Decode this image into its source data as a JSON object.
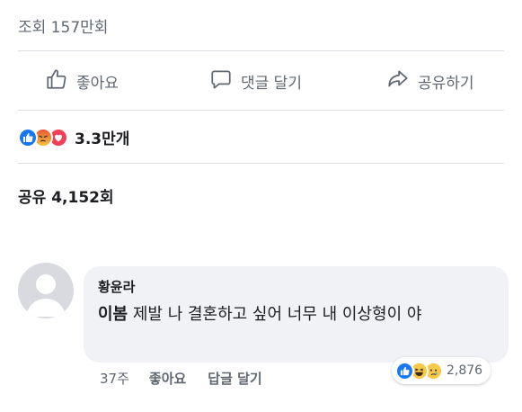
{
  "post": {
    "views": "조회 157만회",
    "actions": {
      "like_label": "좋아요",
      "comment_label": "댓글 달기",
      "share_label": "공유하기"
    },
    "reactions": {
      "icons": [
        "like-icon",
        "angry-icon",
        "love-icon"
      ],
      "count": "3.3만개"
    },
    "shares": "공유 4,152회"
  },
  "comment": {
    "author": "황윤라",
    "tagged_name": "이봄",
    "text": " 제발 나 결혼하고 싶어 너무 내 이상형이 야",
    "time": "37주",
    "like_label": "좋아요",
    "reply_label": "답글 달기",
    "reactions": {
      "icons": [
        "like-icon",
        "haha-icon",
        "sad-icon"
      ],
      "count": "2,876"
    }
  },
  "colors": {
    "like_blue": "#1877f2",
    "love_red": "#f33e58",
    "emoji_yellow": "#f7c948",
    "secondary_text": "#606770",
    "bubble_bg": "#f0f2f5"
  }
}
